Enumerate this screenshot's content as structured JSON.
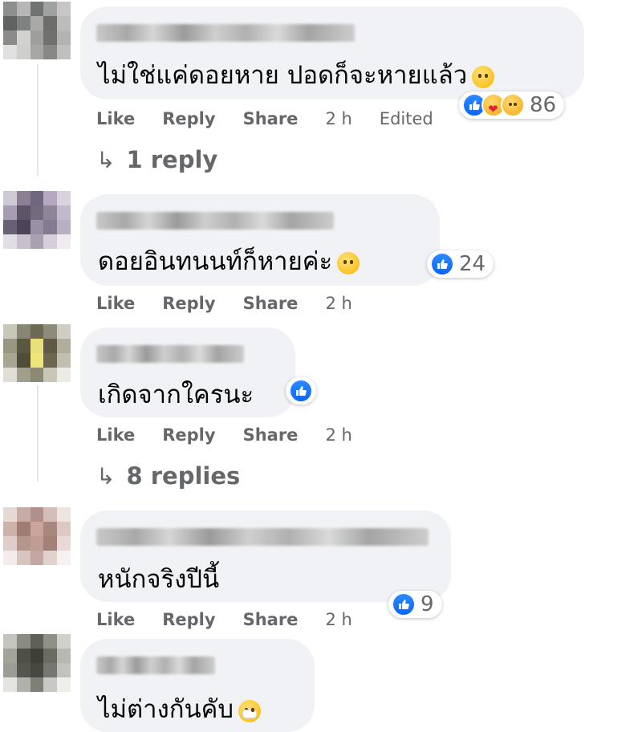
{
  "comments": [
    {
      "text": "ไม่ใช่แค่ดอยหาย ปอดก็จะหายแล้ว",
      "emoji": "sad-tear-emoji",
      "reactions": [
        "like",
        "care",
        "sad"
      ],
      "reaction_count": "86",
      "actions": {
        "like": "Like",
        "reply": "Reply",
        "share": "Share"
      },
      "time": "2 h",
      "edited": "Edited",
      "replies_label": "1 reply",
      "avatar_colors": [
        "#8d8f8e",
        "#b7b6b4",
        "#6f7372",
        "#9fa2a1",
        "#c8c7c5",
        "#5f6463",
        "#7e8382",
        "#a9aaa8",
        "#6d6e6c",
        "#bcbdbb",
        "#8b8c8a",
        "#d2d2d0",
        "#9c9f9e",
        "#71726f",
        "#b3b4b2",
        "#e1e1df",
        "#cfd0ce",
        "#a7a8a6",
        "#888986",
        "#c0c1bf"
      ]
    },
    {
      "text": "ดอยอินทนนท์ก็หายค่ะ",
      "emoji": "crying-emoji",
      "reactions": [
        "like"
      ],
      "reaction_count": "24",
      "actions": {
        "like": "Like",
        "reply": "Reply",
        "share": "Share"
      },
      "time": "2 h",
      "avatar_colors": [
        "#cfc9d4",
        "#8a7f93",
        "#6f6680",
        "#b4a9bf",
        "#d9d3de",
        "#a79db2",
        "#5e5466",
        "#746a7e",
        "#8e8698",
        "#c2bacb",
        "#6a6076",
        "#4d4257",
        "#9b8fa6",
        "#857b90",
        "#b8b0c1",
        "#e2dee5",
        "#c7bfcc",
        "#a9a1b1",
        "#d4cfd8",
        "#efecf1"
      ]
    },
    {
      "text": "เกิดจากใครนะ",
      "reactions": [
        "like"
      ],
      "actions": {
        "like": "Like",
        "reply": "Reply",
        "share": "Share"
      },
      "time": "2 h",
      "replies_label": "8 replies",
      "avatar_colors": [
        "#c9c7ba",
        "#878576",
        "#6c6a55",
        "#8d8b79",
        "#d0cec4",
        "#9a9684",
        "#5a5840",
        "#e8e07a",
        "#5e5a45",
        "#b0ad9d",
        "#a8a593",
        "#4f4c38",
        "#f0e57a",
        "#6a6650",
        "#c2bfb1",
        "#e0ded6",
        "#a19e8c",
        "#8b8874",
        "#c9c6b8",
        "#ecebe6"
      ]
    },
    {
      "text": "หนักจริงปีนี้",
      "reactions": [
        "like"
      ],
      "reaction_count": "9",
      "actions": {
        "like": "Like",
        "reply": "Reply",
        "share": "Share"
      },
      "time": "2 h",
      "avatar_colors": [
        "#e6d9d6",
        "#c7aca6",
        "#b19089",
        "#d3bdb8",
        "#eee5e3",
        "#cdb2ac",
        "#9f7c74",
        "#c9a59c",
        "#a8877f",
        "#dcc9c4",
        "#dfcdc9",
        "#b6958d",
        "#bf9d95",
        "#a38178",
        "#e7dad6",
        "#f3ecea",
        "#d8c5c0",
        "#c3a7a0",
        "#e2d2ce",
        "#f7f2f1"
      ]
    },
    {
      "text": "ไม่ต่างกันคับ",
      "emoji": "mask-emoji",
      "avatar_colors": [
        "#c4c5c0",
        "#8a8b83",
        "#5f6057",
        "#8f9088",
        "#d0d1cc",
        "#a2a39b",
        "#4e4f46",
        "#3e3f37",
        "#6a6b62",
        "#b7b8b2",
        "#9b9c94",
        "#55564d",
        "#47483f",
        "#76776e",
        "#c2c3bd",
        "#e4e5e1",
        "#b0b1ab",
        "#7e7f77",
        "#c8c9c4",
        "#eeeeeb"
      ]
    }
  ]
}
